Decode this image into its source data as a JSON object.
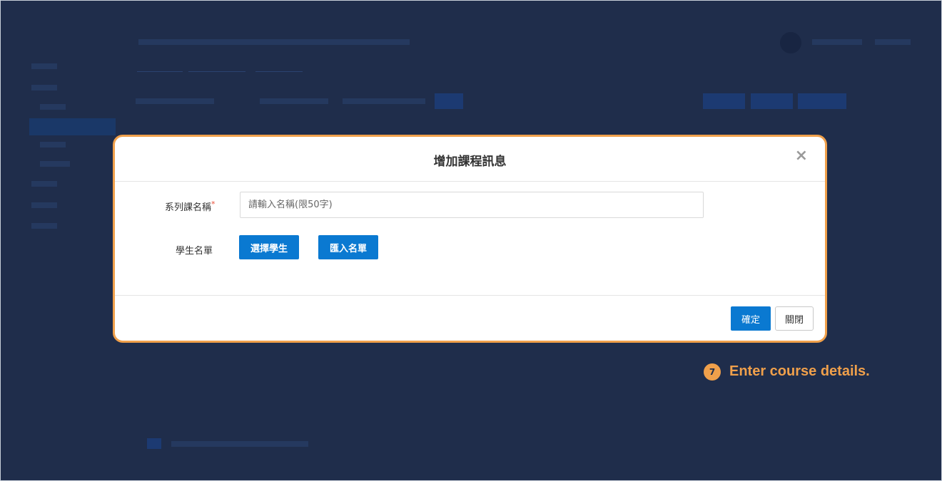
{
  "modal": {
    "title": "增加課程訊息",
    "close_glyph": "×",
    "series_name_label": "系列課名稱",
    "required_mark": "*",
    "series_name_placeholder": "請輸入名稱(限50字)",
    "series_name_value": "",
    "student_list_label": "學生名單",
    "select_students_button": "選擇學生",
    "import_list_button": "匯入名單",
    "confirm_button": "確定",
    "close_button": "關閉"
  },
  "annotation": {
    "step_number": "7",
    "text": "Enter course details."
  },
  "colors": {
    "overlay_background": "#1f2d4b",
    "accent_orange": "#f0a04b",
    "primary_blue": "#0a79d1"
  },
  "icons": {
    "close": "close-icon"
  }
}
